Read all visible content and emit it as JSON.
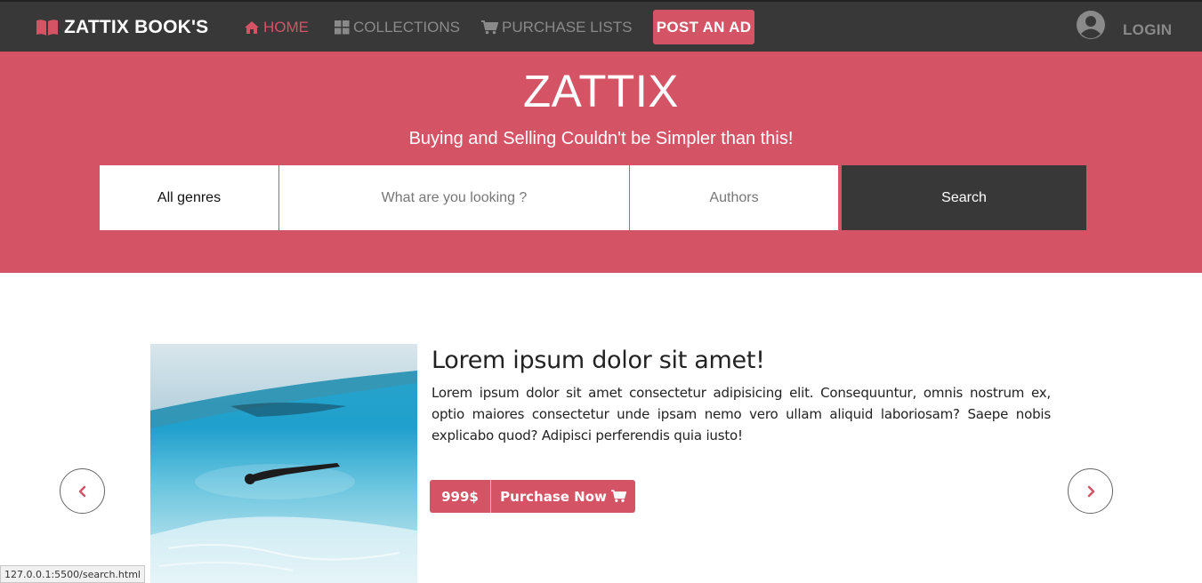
{
  "navbar": {
    "brand": "ZATTIX BOOK'S",
    "items": [
      {
        "label": "HOME",
        "icon": "home-icon",
        "active": true
      },
      {
        "label": "COLLECTIONS",
        "icon": "grid-icon",
        "active": false
      },
      {
        "label": "PURCHASE LISTS",
        "icon": "cart-icon",
        "active": false
      }
    ],
    "post_ad": "POST AN AD",
    "login": "LOGIN"
  },
  "hero": {
    "title": "ZATTIX",
    "subtitle": "Buying and Selling Couldn't be Simpler than this!",
    "search": {
      "genre": "All genres",
      "query_placeholder": "What are you looking ?",
      "authors_placeholder": "Authors",
      "button": "Search"
    }
  },
  "carousel": {
    "title": "Lorem ipsum dolor sit amet!",
    "text": "Lorem ipsum dolor sit amet consectetur adipisicing elit. Consequuntur, omnis nostrum ex, optio maiores consectetur unde ipsam nemo vero ullam aliquid laboriosam? Saepe nobis explicabo quod? Adipisci perferendis quia iusto!",
    "price": "999$",
    "purchase": "Purchase Now"
  },
  "status_url": "127.0.0.1:5500/search.html",
  "colors": {
    "accent": "#d45466",
    "dark": "#383838"
  }
}
